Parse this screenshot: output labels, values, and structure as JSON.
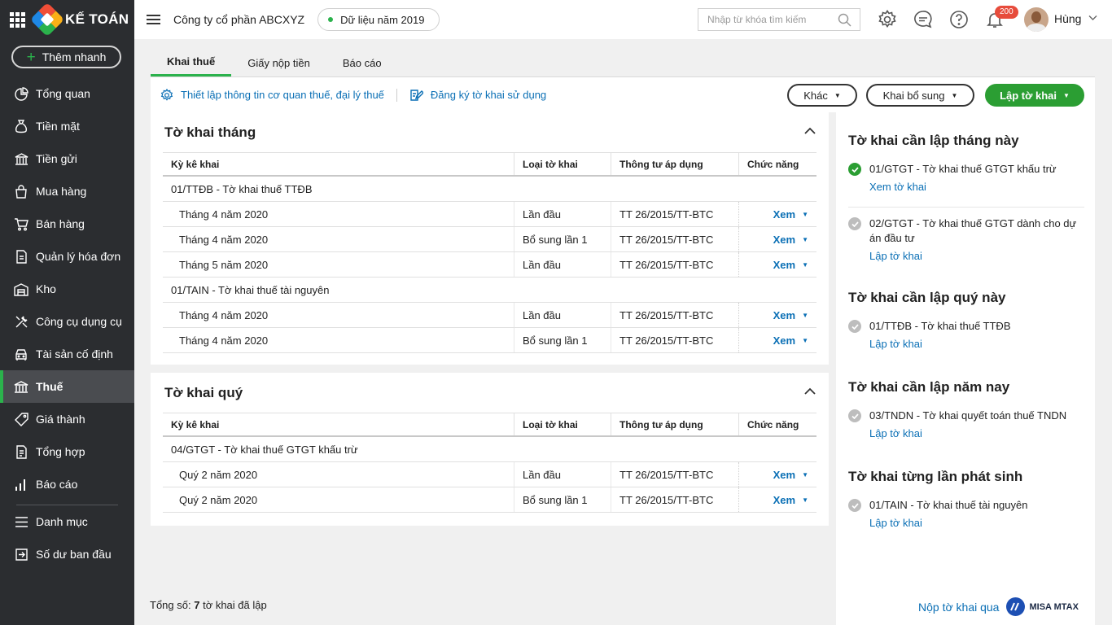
{
  "app": {
    "logo_text": "KẾ TOÁN",
    "quick_add_label": "Thêm nhanh",
    "nav_items": [
      {
        "label": "Tổng quan",
        "icon": "dashboard-icon"
      },
      {
        "label": "Tiền mặt",
        "icon": "money-bag-icon"
      },
      {
        "label": "Tiền gửi",
        "icon": "bank-icon"
      },
      {
        "label": "Mua hàng",
        "icon": "shopping-bag-icon"
      },
      {
        "label": "Bán hàng",
        "icon": "cart-icon"
      },
      {
        "label": "Quản lý hóa đơn",
        "icon": "invoice-icon"
      },
      {
        "label": "Kho",
        "icon": "warehouse-icon"
      },
      {
        "label": "Công cụ dụng cụ",
        "icon": "tools-icon"
      },
      {
        "label": "Tài sản cố định",
        "icon": "car-icon"
      },
      {
        "label": "Thuế",
        "icon": "tax-building-icon",
        "active": true
      },
      {
        "label": "Giá thành",
        "icon": "price-tag-icon"
      },
      {
        "label": "Tổng hợp",
        "icon": "summary-doc-icon"
      },
      {
        "label": "Báo cáo",
        "icon": "bar-chart-icon"
      },
      {
        "label": "Danh mục",
        "icon": "list-icon"
      },
      {
        "label": "Số dư ban đầu",
        "icon": "opening-balance-icon"
      }
    ]
  },
  "topbar": {
    "company": "Công ty cổ phần ABCXYZ",
    "data_year": "Dữ liệu năm 2019",
    "search_placeholder": "Nhập từ khóa tìm kiếm",
    "notification_count": "200",
    "user_name": "Hùng"
  },
  "tabs": [
    "Khai thuế",
    "Giấy nộp tiền",
    "Báo cáo"
  ],
  "toolbar": {
    "setup_link": "Thiết lập thông tin cơ quan thuế, đại lý thuế",
    "register_link": "Đăng ký tờ khai sử dụng",
    "other_btn": "Khác",
    "supplement_btn": "Khai bổ sung",
    "create_btn": "Lập tờ khai"
  },
  "headers": {
    "period": "Kỳ kê khai",
    "type": "Loại tờ khai",
    "circular": "Thông tư áp dụng",
    "action": "Chức năng"
  },
  "monthly": {
    "title": "Tờ khai tháng",
    "groups": [
      {
        "name": "01/TTĐB - Tờ khai thuế TTĐB",
        "rows": [
          {
            "period": "Tháng 4 năm 2020",
            "type": "Lần đầu",
            "circular": "TT 26/2015/TT-BTC",
            "action": "Xem"
          },
          {
            "period": "Tháng 4 năm 2020",
            "type": "Bổ sung lần 1",
            "circular": "TT 26/2015/TT-BTC",
            "action": "Xem"
          },
          {
            "period": "Tháng 5 năm 2020",
            "type": "Lần đầu",
            "circular": "TT 26/2015/TT-BTC",
            "action": "Xem"
          }
        ]
      },
      {
        "name": "01/TAIN - Tờ khai thuế tài nguyên",
        "rows": [
          {
            "period": "Tháng 4 năm 2020",
            "type": "Lần đầu",
            "circular": "TT 26/2015/TT-BTC",
            "action": "Xem"
          },
          {
            "period": "Tháng 4 năm 2020",
            "type": "Bổ sung lần 1",
            "circular": "TT 26/2015/TT-BTC",
            "action": "Xem"
          }
        ]
      }
    ]
  },
  "quarterly": {
    "title": "Tờ khai quý",
    "groups": [
      {
        "name": "04/GTGT - Tờ khai thuế GTGT khấu trừ",
        "rows": [
          {
            "period": "Quý 2 năm 2020",
            "type": "Lần đầu",
            "circular": "TT 26/2015/TT-BTC",
            "action": "Xem"
          },
          {
            "period": "Quý 2 năm 2020",
            "type": "Bổ sung lần 1",
            "circular": "TT 26/2015/TT-BTC",
            "action": "Xem"
          }
        ]
      }
    ]
  },
  "footer": {
    "prefix": "Tổng số:",
    "count": "7",
    "suffix": "tờ khai đã lập"
  },
  "right_panel": {
    "month_title": "Tờ khai cần lập tháng này",
    "month_items": [
      {
        "text": "01/GTGT - Tờ khai thuế GTGT khấu trừ",
        "link": "Xem tờ khai",
        "done": true
      },
      {
        "text": "02/GTGT - Tờ khai thuế GTGT dành cho dự án đầu tư",
        "link": "Lập tờ khai",
        "done": false
      }
    ],
    "quarter_title": "Tờ khai cần lập quý này",
    "quarter_items": [
      {
        "text": "01/TTĐB - Tờ khai thuế TTĐB",
        "link": "Lập tờ khai"
      }
    ],
    "year_title": "Tờ khai cần lập năm nay",
    "year_items": [
      {
        "text": "03/TNDN - Tờ khai quyết toán thuế TNDN",
        "link": "Lập tờ khai"
      }
    ],
    "incident_title": "Tờ khai từng lần phát sinh",
    "incident_items": [
      {
        "text": "01/TAIN - Tờ khai thuế tài nguyên",
        "link": "Lập tờ khai"
      }
    ],
    "submit_link": "Nộp tờ khai qua",
    "mtax_logo": "MISA MTAX"
  }
}
